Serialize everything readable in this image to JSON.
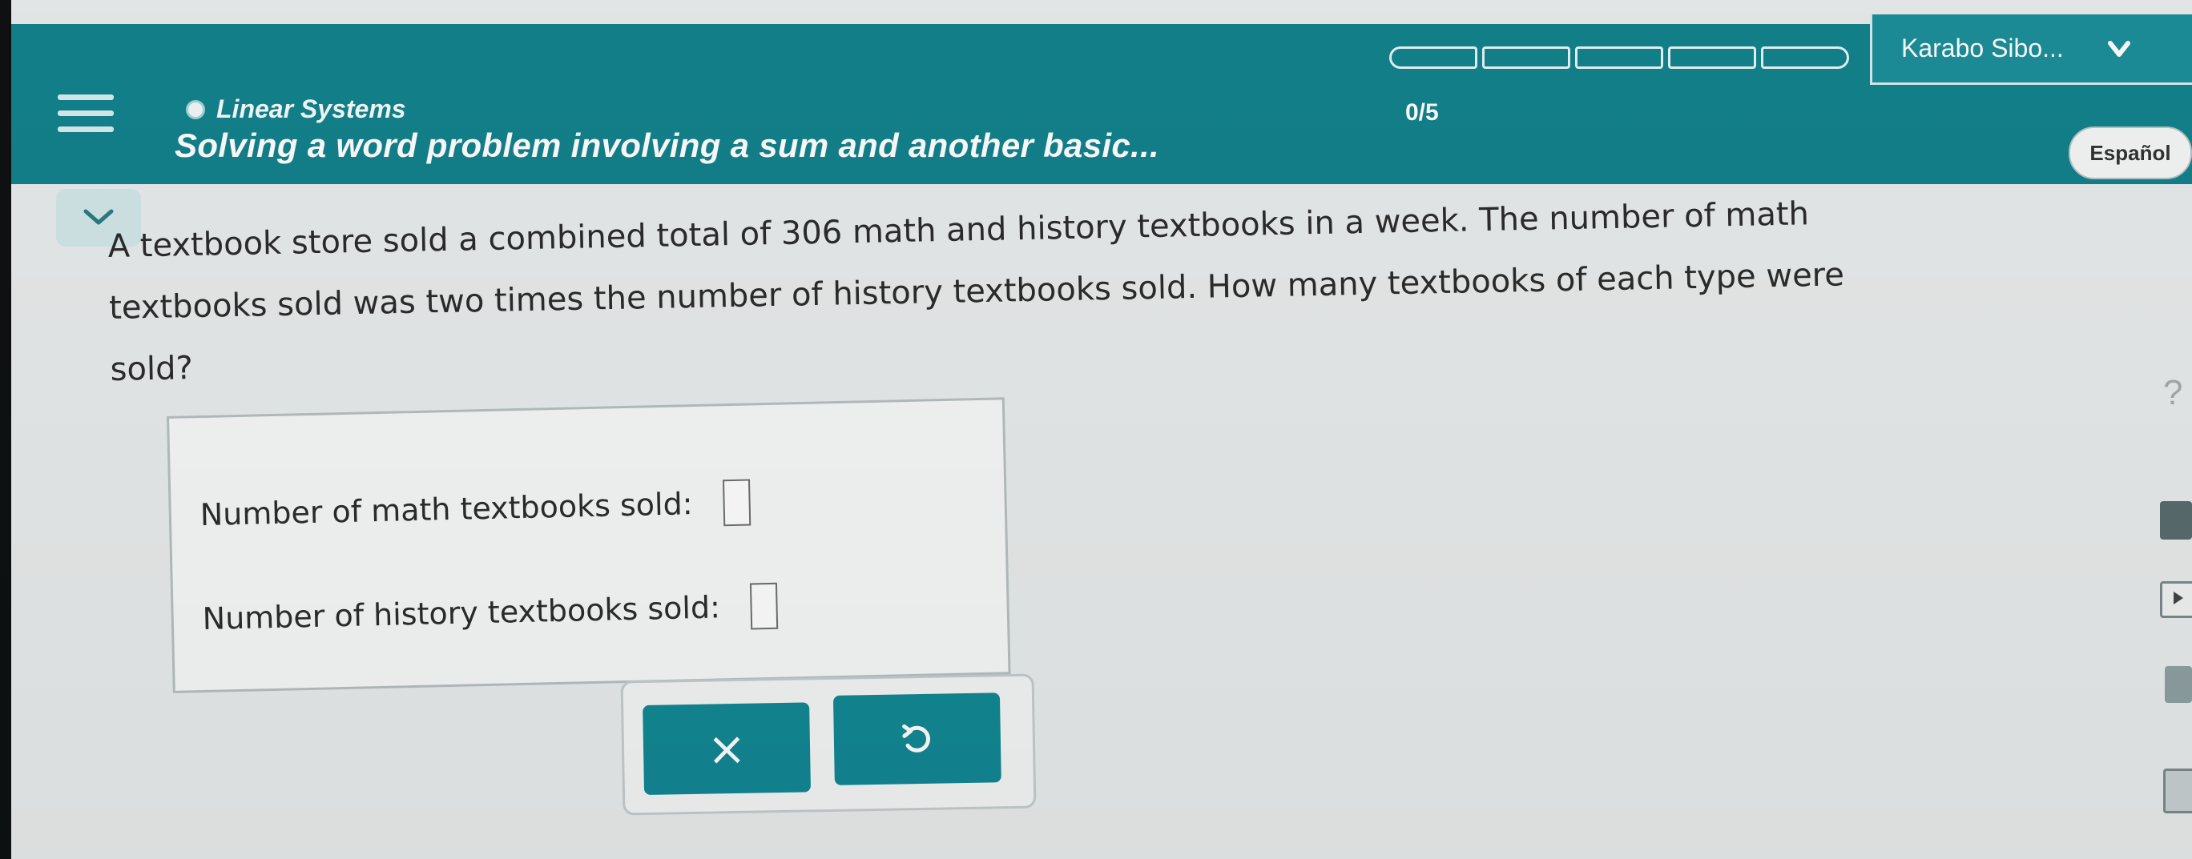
{
  "header": {
    "topic": "Linear Systems",
    "subtitle": "Solving a word problem involving a sum and another basic...",
    "progress": "0/5",
    "progress_fraction": 0,
    "progress_segments": 5,
    "user_name": "Karabo Sibo...",
    "language_button": "Español"
  },
  "problem": {
    "line1": "A textbook store sold a combined total of 306 math and history textbooks in a week. The number of math",
    "line2": "textbooks sold was two times the number of history textbooks sold. How many textbooks of each type were",
    "line3": "sold?"
  },
  "answers": {
    "math_label": "Number of math textbooks sold:",
    "math_value": "",
    "history_label": "Number of history textbooks sold:",
    "history_value": ""
  },
  "buttons": {
    "clear_symbol": "×"
  },
  "side_tools": {
    "help_symbol": "?"
  },
  "colors": {
    "header_bg": "#13828c",
    "button_bg": "#128894",
    "page_bg": "#e9ecec"
  },
  "icons": [
    "menu-icon",
    "chevron-down-icon",
    "help-icon",
    "calculator-icon",
    "video-icon",
    "table-icon",
    "document-icon",
    "undo-icon"
  ]
}
